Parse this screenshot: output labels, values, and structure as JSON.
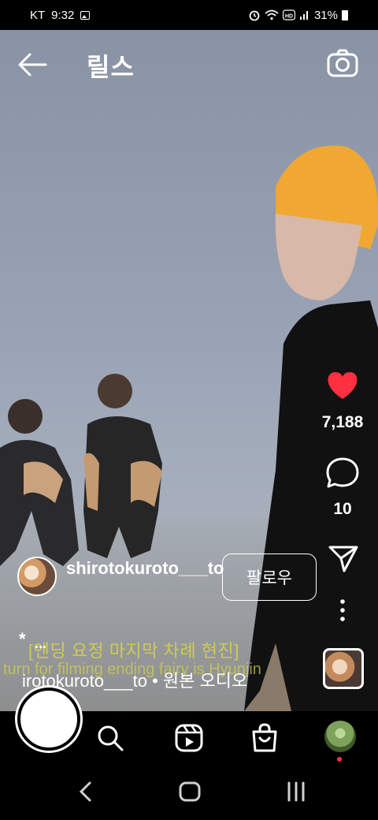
{
  "status_bar": {
    "carrier": "KT",
    "time": "9:32",
    "battery": "31%"
  },
  "header": {
    "title": "릴스",
    "back_icon": "arrow-left-icon",
    "camera_icon": "camera-icon"
  },
  "actions": {
    "like_count": "7,188",
    "comment_count": "10",
    "like_color": "#ff3040"
  },
  "author": {
    "name": "shirotokuroto___to",
    "follow_label": "팔로우"
  },
  "caption": {
    "star": "*",
    "more": "...",
    "subtitle_ko": "[엔딩 요정 마지막 차례 현진]",
    "subtitle_en": "turn for filming ending fairy is Hyunjin"
  },
  "audio": {
    "text": "irotokuroto___to • 원본 오디오"
  },
  "nav": {
    "items": [
      "home-icon",
      "search-icon",
      "reels-icon",
      "shop-icon",
      "profile-avatar"
    ]
  }
}
